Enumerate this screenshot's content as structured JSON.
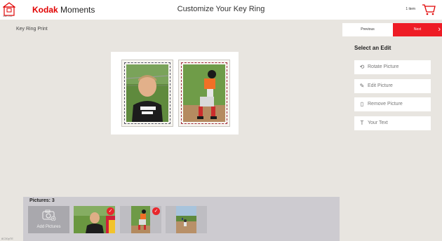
{
  "header": {
    "home_label": "Start Over",
    "brand_name": "Kodak",
    "brand_suffix": "Moments",
    "page_title": "Customize Your Key Ring",
    "cart_count": "1 item"
  },
  "product": {
    "title": "Key Ring Print"
  },
  "navigation": {
    "previous_label": "Previous",
    "next_label": "Next"
  },
  "edit_panel": {
    "heading": "Select an Edit",
    "actions": [
      {
        "label": "Rotate Picture",
        "icon": "rotate-icon"
      },
      {
        "label": "Edit Picture",
        "icon": "edit-icon"
      },
      {
        "label": "Remove Picture",
        "icon": "trash-icon"
      },
      {
        "label": "Your Text",
        "icon": "text-icon"
      }
    ]
  },
  "tray": {
    "title": "Pictures: 3",
    "add_label": "Add Pictures",
    "thumbnails": [
      {
        "name": "photo-1",
        "selected": true
      },
      {
        "name": "photo-2",
        "selected": true
      },
      {
        "name": "photo-3",
        "selected": false
      }
    ]
  },
  "footer": {
    "version": "8C30pTE"
  },
  "colors": {
    "accent": "#ee1c25",
    "check": "#e8262c",
    "background": "#e8e5e0"
  }
}
